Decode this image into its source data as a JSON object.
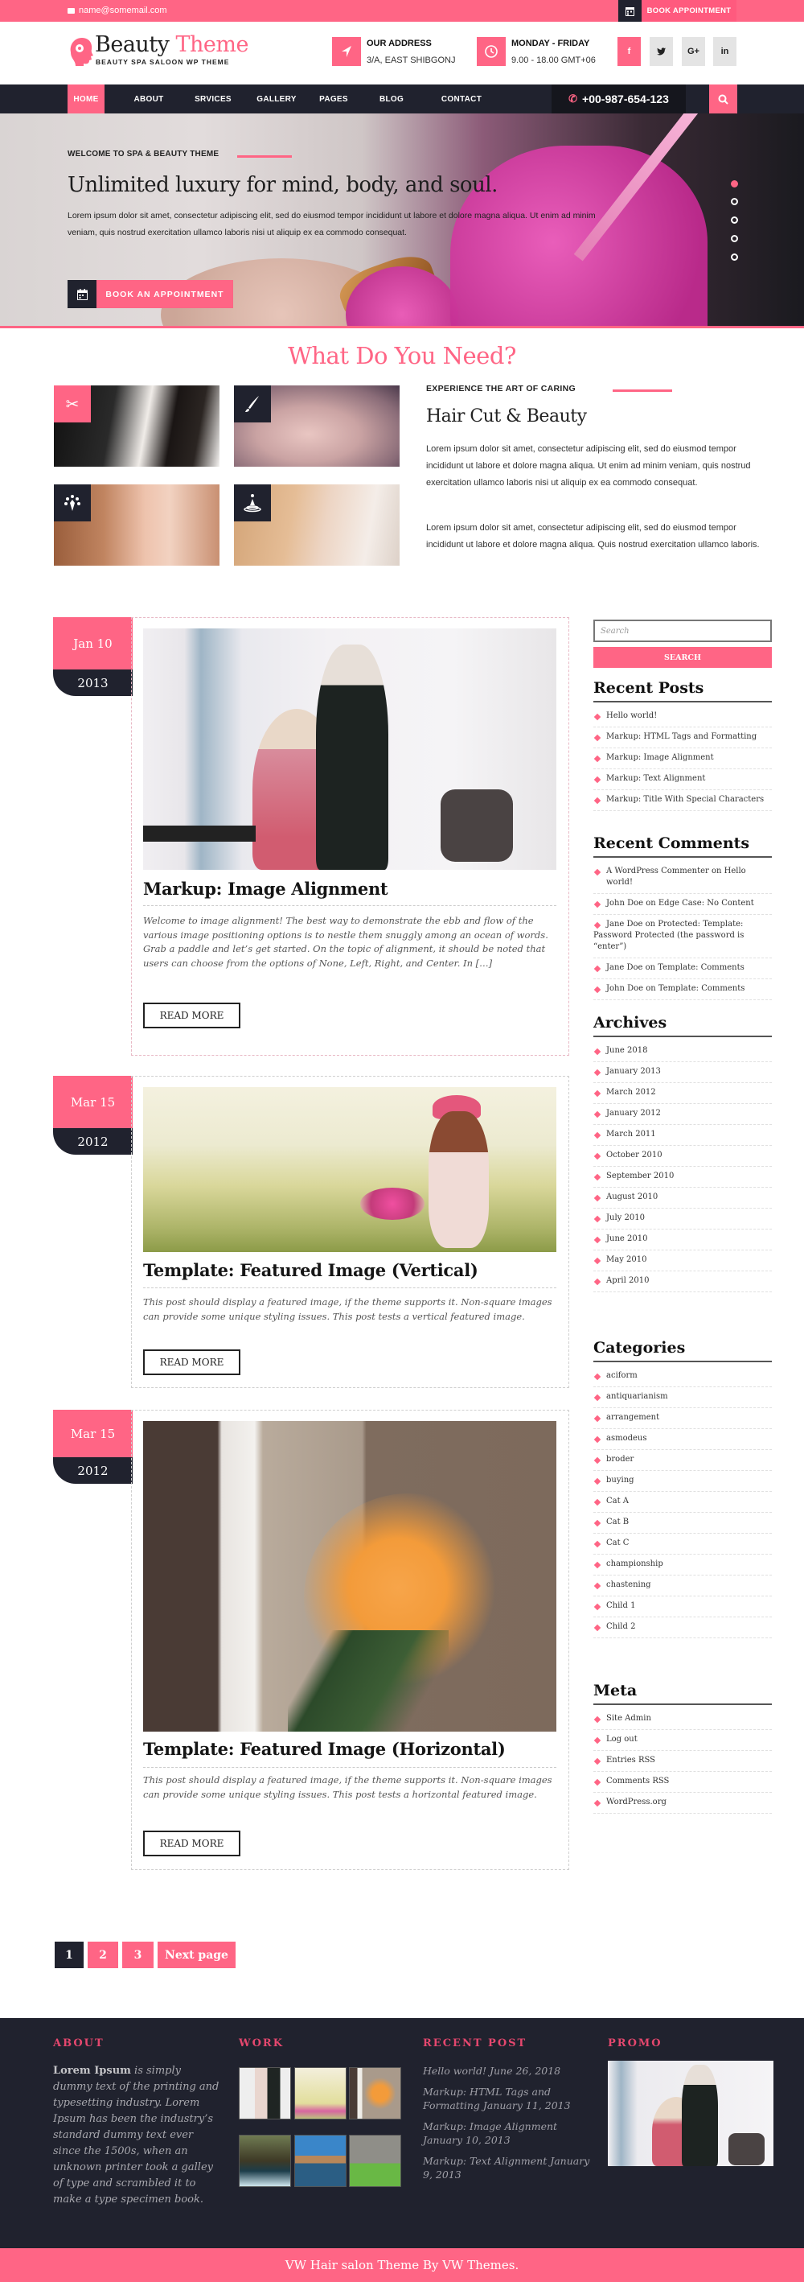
{
  "topbar": {
    "email": "name@somemail.com",
    "book_label": "BOOK APPOINTMENT"
  },
  "header": {
    "logo_word1": "Beauty",
    "logo_word2": "Theme",
    "tagline": "BEAUTY SPA SALOON WP THEME",
    "address_heading": "OUR ADDRESS",
    "address_value": "3/A, EAST SHIBGONJ",
    "hours_heading": "MONDAY - FRIDAY",
    "hours_value": "9.00 - 18.00 GMT+06",
    "social": [
      "f",
      "t",
      "G+",
      "in"
    ]
  },
  "nav": {
    "items": [
      "HOME",
      "ABOUT",
      "SRVICES",
      "GALLERY",
      "PAGES",
      "BLOG",
      "CONTACT"
    ],
    "active": "HOME",
    "phone": "+00-987-654-123"
  },
  "hero": {
    "kicker": "WELCOME TO SPA & BEAUTY THEME",
    "title": "Unlimited luxury for mind, body, and soul.",
    "text": "Lorem ipsum dolor sit amet, consectetur adipiscing elit, sed do eiusmod tempor incididunt ut labore et dolore magna aliqua. Ut enim ad minim veniam, quis nostrud exercitation ullamco laboris nisi ut aliquip ex ea commodo consequat.",
    "button": "BOOK AN APPOINTMENT",
    "slides_count": 5,
    "active_slide": 1
  },
  "services": {
    "heading": "What Do You Need?",
    "kicker": "EXPERIENCE THE ART OF CARING",
    "title": "Hair Cut & Beauty",
    "para1": "Lorem ipsum dolor sit amet, consectetur adipiscing elit, sed do eiusmod tempor incididunt ut labore et dolore magna aliqua. Ut enim ad minim veniam, quis nostrud exercitation ullamco laboris nisi ut aliquip ex ea commodo consequat.",
    "para2": "Lorem ipsum dolor sit amet, consectetur adipiscing elit, sed do eiusmod tempor incididunt ut labore et dolore magna aliqua. Quis nostrud exercitation ullamco laboris.",
    "tiles": [
      {
        "icon": "scissors-comb-icon"
      },
      {
        "icon": "brush-icon"
      },
      {
        "icon": "tree-person-icon"
      },
      {
        "icon": "water-drop-icon"
      }
    ]
  },
  "posts": [
    {
      "date": "Jan 10",
      "year": "2013",
      "title": "Markup: Image Alignment",
      "excerpt": "Welcome to image alignment! The best way to demonstrate the ebb and flow of the various image positioning options is to nestle them snuggly among an ocean of words. Grab a paddle and let’s get started. On the topic of alignment, it should be noted that users can choose from the options of None, Left, Right, and Center. In […]",
      "button": "READ MORE"
    },
    {
      "date": "Mar 15",
      "year": "2012",
      "title": "Template: Featured Image (Vertical)",
      "excerpt": "This post should display a featured image, if the theme supports it. Non-square images can provide some unique styling issues. This post tests a vertical featured image.",
      "button": "READ MORE"
    },
    {
      "date": "Mar 15",
      "year": "2012",
      "title": "Template: Featured Image (Horizontal)",
      "excerpt": "This post should display a featured image, if the theme supports it. Non-square images can provide some unique styling issues. This post tests a horizontal featured image.",
      "button": "READ MORE"
    }
  ],
  "sidebar": {
    "search_placeholder": "Search",
    "search_button": "SEARCH",
    "recent_posts_title": "Recent Posts",
    "recent_posts": [
      "Hello world!",
      "Markup: HTML Tags and Formatting",
      "Markup: Image Alignment",
      "Markup: Text Alignment",
      "Markup: Title With Special Characters"
    ],
    "recent_comments_title": "Recent Comments",
    "recent_comments": [
      "A WordPress Commenter on Hello world!",
      "John Doe on Edge Case: No Content",
      "Jane Doe on Protected: Template: Password Protected (the password is “enter”)",
      "Jane Doe on Template: Comments",
      "John Doe on Template: Comments"
    ],
    "archives_title": "Archives",
    "archives": [
      "June 2018",
      "January 2013",
      "March 2012",
      "January 2012",
      "March 2011",
      "October 2010",
      "September 2010",
      "August 2010",
      "July 2010",
      "June 2010",
      "May 2010",
      "April 2010"
    ],
    "categories_title": "Categories",
    "categories": [
      "aciform",
      "antiquarianism",
      "arrangement",
      "asmodeus",
      "broder",
      "buying",
      "Cat A",
      "Cat B",
      "Cat C",
      "championship",
      "chastening",
      "Child 1",
      "Child 2"
    ],
    "meta_title": "Meta",
    "meta": [
      "Site Admin",
      "Log out",
      "Entries RSS",
      "Comments RSS",
      "WordPress.org"
    ]
  },
  "pagination": {
    "pages": [
      "1",
      "2",
      "3"
    ],
    "current": "1",
    "next": "Next page"
  },
  "footer": {
    "about_title": "ABOUT",
    "about_bold": "Lorem Ipsum",
    "about_text": " is simply dummy text of the printing and typesetting industry. Lorem Ipsum has been the industry’s standard dummy text ever since the 1500s, when an unknown printer took a galley of type and scrambled it to make a type specimen book.",
    "work_title": "WORK",
    "recent_title": "RECENT POST",
    "recent": [
      "Hello world! June 26, 2018",
      "Markup: HTML Tags and Formatting January 11, 2013",
      "Markup: Image Alignment January 10, 2013",
      "Markup: Text Alignment January 9, 2013"
    ],
    "promo_title": "PROMO",
    "copyright": "VW Hair salon Theme By VW Themes."
  },
  "colors": {
    "accent": "#ff6585",
    "dark": "#20222e"
  }
}
